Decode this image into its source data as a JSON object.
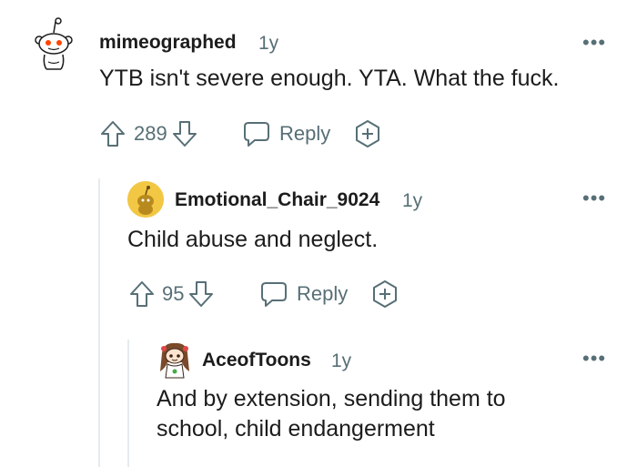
{
  "comments": [
    {
      "username": "mimeographed",
      "age": "1y",
      "text": "YTB isn't severe enough. YTA. What the fuck.",
      "votes": "289",
      "reply_label": "Reply",
      "more": "•••"
    },
    {
      "username": "Emotional_Chair_9024",
      "age": "1y",
      "text": "Child abuse and neglect.",
      "votes": "95",
      "reply_label": "Reply",
      "more": "•••"
    },
    {
      "username": "AceofToons",
      "age": "1y",
      "text_lines": [
        "And by extension, sending them to",
        "school, child endangerment"
      ],
      "more": "•••"
    }
  ],
  "colors": {
    "meta_gray": "#576f76",
    "text": "#1c1c1c",
    "thread_line": "#e5ebee",
    "avatar_yellow": "#f2c744",
    "reddit_orange": "#ff4500"
  },
  "icons": [
    "snoo-avatar",
    "upvote-icon",
    "downvote-icon",
    "reply-icon",
    "award-icon",
    "more-icon"
  ]
}
